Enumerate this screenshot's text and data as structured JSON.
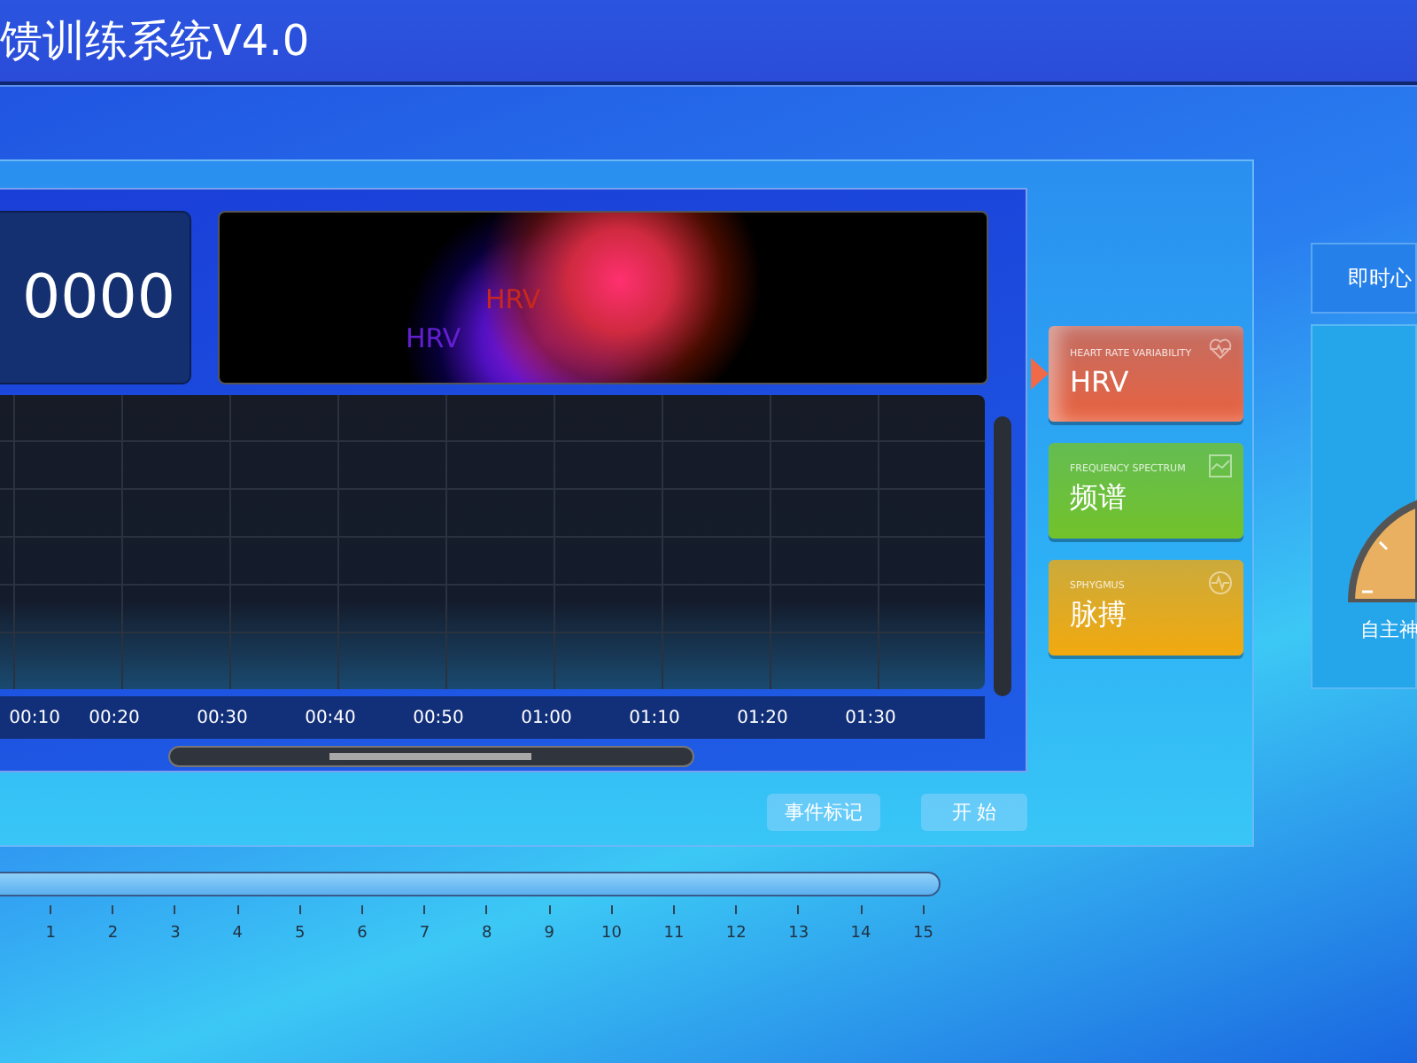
{
  "header": {
    "title": "馈训练系统V4.0"
  },
  "counter": {
    "value": "0000"
  },
  "glow_view": {
    "labels": [
      {
        "text": "HRV",
        "color": "#c8281e"
      },
      {
        "text": "HRV",
        "color": "#6420d0"
      }
    ]
  },
  "timeline": {
    "ticks": [
      "00:10",
      "00:20",
      "00:30",
      "00:40",
      "00:50",
      "01:00",
      "01:10",
      "01:20",
      "01:30"
    ]
  },
  "buttons": [
    {
      "label": "事件标记"
    },
    {
      "label": "开 始"
    }
  ],
  "modes": [
    {
      "subtitle": "HEART RATE VARIABILITY",
      "label": "HRV",
      "color": "#e8613f",
      "kind": "heart",
      "selected": true
    },
    {
      "subtitle": "FREQUENCY SPECTRUM",
      "label": "频谱",
      "color": "#72c22a",
      "kind": "spectrum",
      "selected": false
    },
    {
      "subtitle": "SPHYGMUS",
      "label": "脉搏",
      "color": "#f2a90e",
      "kind": "pulse",
      "selected": false
    }
  ],
  "right_panel": {
    "title": "即时心",
    "gauge_label": "自主神"
  },
  "scale": {
    "ticks": [
      "1",
      "2",
      "3",
      "4",
      "5",
      "6",
      "7",
      "8",
      "9",
      "10",
      "11",
      "12",
      "13",
      "14",
      "15"
    ]
  }
}
